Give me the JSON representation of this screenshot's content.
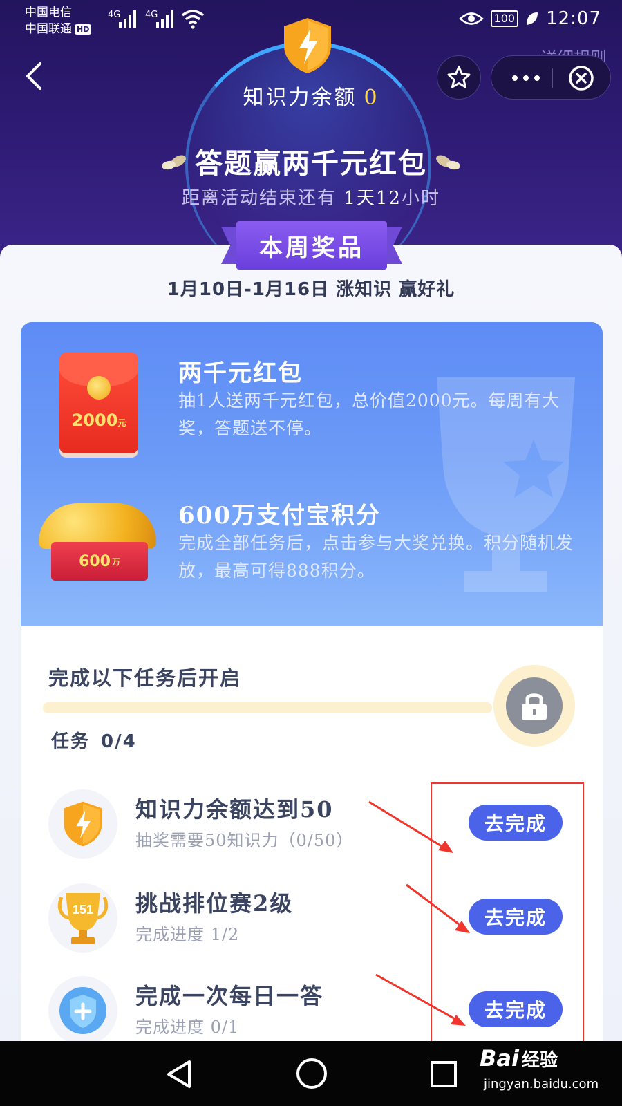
{
  "status_bar": {
    "carrier1": "中国电信",
    "carrier2": "中国联通",
    "hd": "HD",
    "net1": "4G",
    "net2": "4G",
    "battery": "100",
    "time": "12:07"
  },
  "header": {
    "rules_link": "详细规则",
    "balance_label": "知识力余额",
    "balance_value": "0",
    "title": "答题赢两千元红包",
    "countdown_prefix": "距离活动结束还有",
    "countdown_value": "1天12",
    "countdown_suffix": "小时"
  },
  "prizes": {
    "ribbon": "本周奖品",
    "dates": "1月10日-1月16日  涨知识  赢好礼",
    "items": [
      {
        "name": "两千元红包",
        "desc": "抽1人送两千元红包，总价值2000元。每周有大奖，答题送不停。",
        "badge_amount": "2000",
        "badge_unit": "元"
      },
      {
        "name": "600万支付宝积分",
        "desc": "完成全部任务后，点击参与大奖兑换。积分随机发放，最高可得888积分。",
        "badge_amount": "600",
        "badge_unit": "万"
      }
    ]
  },
  "tasks": {
    "unlock_title": "完成以下任务后开启",
    "count_label": "任务",
    "count_value": "0/4",
    "progress": 0.0,
    "list": [
      {
        "name": "知识力余额达到50",
        "sub": "抽奖需要50知识力（0/50）",
        "button": "去完成",
        "icon": "lightning-shield-icon"
      },
      {
        "name": "挑战排位赛2级",
        "sub": "完成进度  1/2",
        "button": "去完成",
        "icon": "trophy-icon",
        "trophy_label": "151"
      },
      {
        "name": "完成一次每日一答",
        "sub": "完成进度  0/1",
        "button": "去完成",
        "icon": "shield-plus-icon"
      }
    ]
  },
  "watermark": {
    "logo": "Bai",
    "logo_cn": "经验",
    "url": "jingyan.baidu.com"
  },
  "colors": {
    "accent": "#4a63e8",
    "header_bg": "#2a1a6e",
    "panel_blue": "#6b9af7",
    "annotation_red": "#f0352c"
  }
}
